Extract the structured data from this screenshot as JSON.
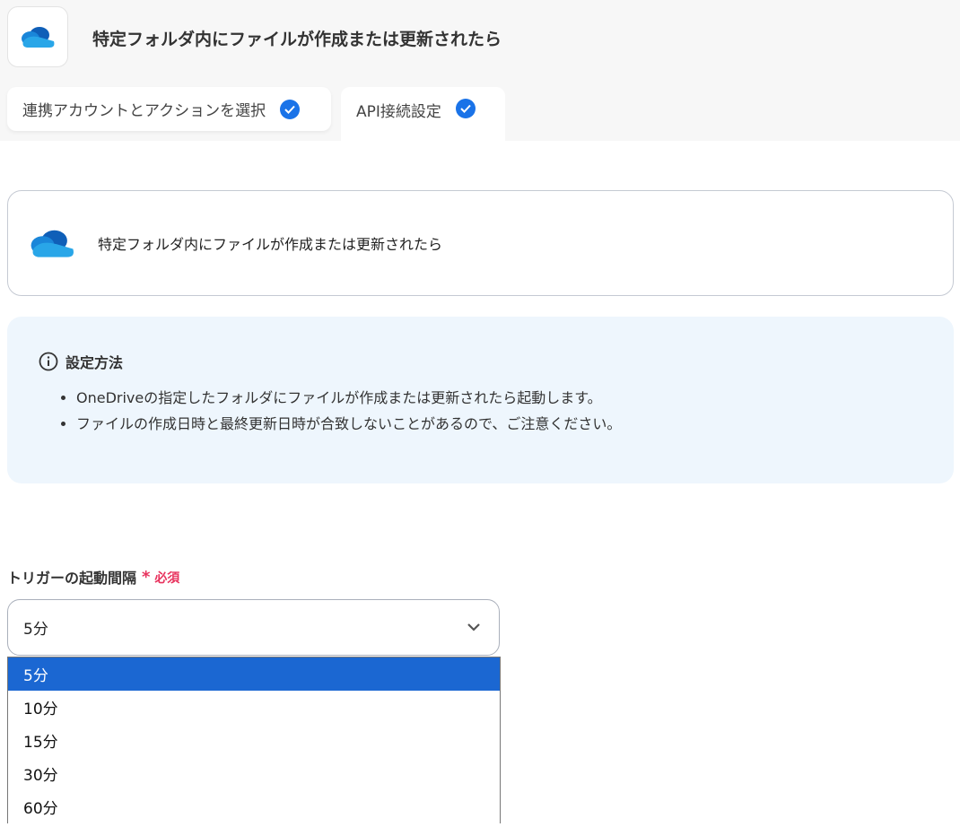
{
  "header": {
    "title": "特定フォルダ内にファイルが作成または更新されたら",
    "app_icon": "onedrive-icon"
  },
  "tabs": [
    {
      "label": "連携アカウントとアクションを選択",
      "status": "completed"
    },
    {
      "label": "API接続設定",
      "status": "completed"
    }
  ],
  "trigger_card": {
    "label": "特定フォルダ内にファイルが作成または更新されたら"
  },
  "info": {
    "heading": "設定方法",
    "bullets": [
      "OneDriveの指定したフォルダにファイルが作成または更新されたら起動します。",
      "ファイルの作成日時と最終更新日時が合致しないことがあるので、ご注意ください。"
    ]
  },
  "field": {
    "label": "トリガーの起動間隔",
    "required_mark": "*",
    "required_text": "必須",
    "value": "5分",
    "options": [
      "5分",
      "10分",
      "15分",
      "30分",
      "60分"
    ],
    "selected_index": 0
  },
  "colors": {
    "accent": "#1a73e8",
    "selected": "#1b67d2",
    "required": "#e8335e",
    "info_bg": "#eef6fd"
  }
}
